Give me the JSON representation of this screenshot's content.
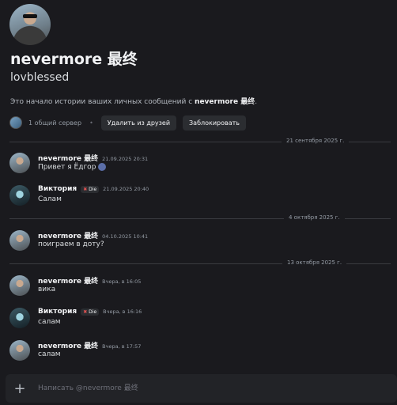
{
  "profile": {
    "display_name": "nevermore 最终",
    "username": "lovblessed",
    "intro_prefix": "Это начало истории ваших личных сообщений с ",
    "intro_name": "nevermore 最终",
    "intro_suffix": ".",
    "mutual_servers": "1 общий сервер",
    "separator": "•",
    "remove_friend": "Удалить из друзей",
    "block": "Заблокировать"
  },
  "dates": {
    "d1": "21 сентября 2025 г.",
    "d2": "4 октября 2025 г.",
    "d3": "13 октября 2025 г."
  },
  "messages": [
    {
      "author": "nevermore 最终",
      "time": "21.09.2025 20:31",
      "text": "Привет я Ёдгор",
      "icon": "emoji-icon"
    },
    {
      "author": "Виктория",
      "tag": "Die",
      "time": "21.09.2025 20:40",
      "text": "Салам"
    },
    {
      "author": "nevermore 最终",
      "time": "04.10.2025 10:41",
      "text": "поиграем в доту?"
    },
    {
      "author": "nevermore 最终",
      "time": "Вчера, в 16:05",
      "text": "вика"
    },
    {
      "author": "Виктория",
      "tag": "Die",
      "time": "Вчера, в 16:16",
      "text": "салам"
    },
    {
      "author": "nevermore 最终",
      "time": "Вчера, в 17:57",
      "text": "салам"
    }
  ],
  "tag_symbol": "✖",
  "composer": {
    "plus": "+",
    "placeholder": "Написать @nevermore 最终"
  }
}
